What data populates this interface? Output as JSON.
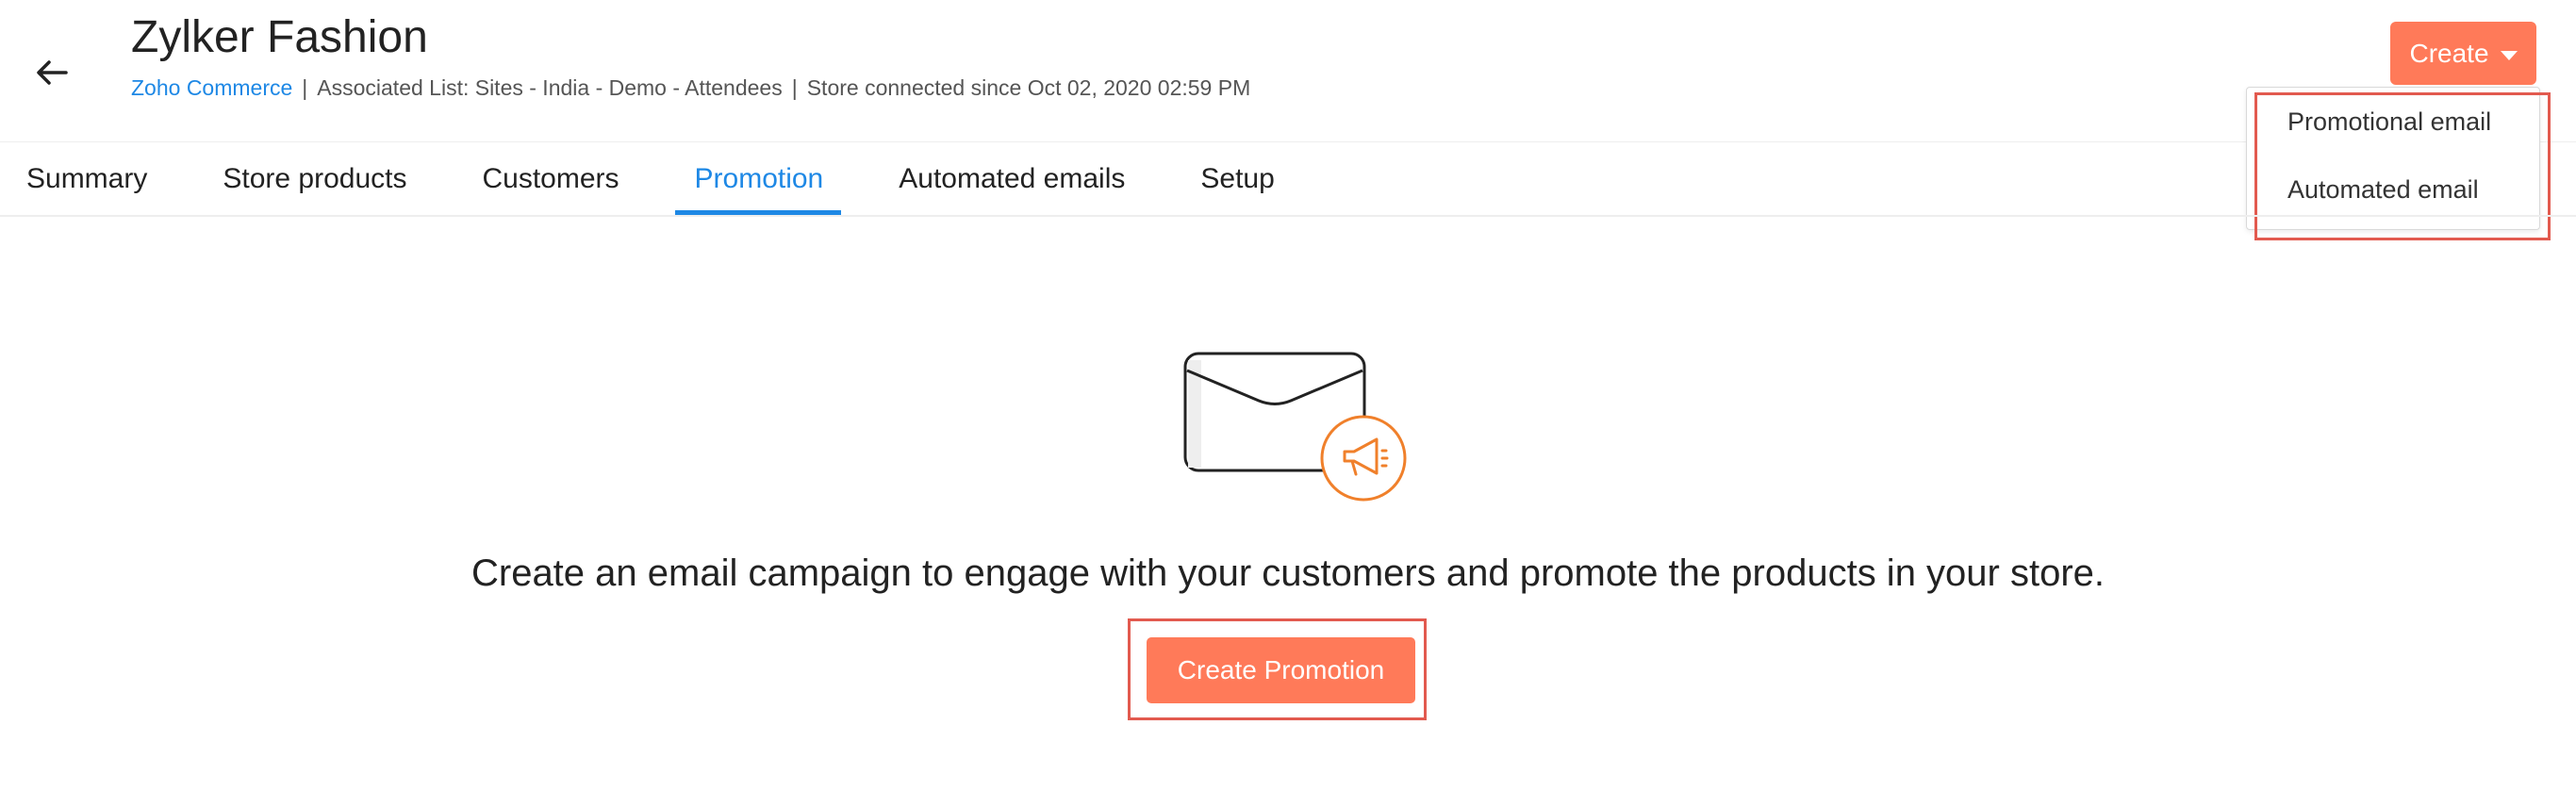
{
  "header": {
    "back_icon": "arrow-left-icon",
    "title": "Zylker Fashion",
    "meta": {
      "platform_link": "Zoho Commerce",
      "associated_list": "Associated List: Sites - India - Demo - Attendees",
      "connected_since": "Store connected since Oct 02, 2020 02:59 PM",
      "separator": "|"
    }
  },
  "create_menu": {
    "button_label": "Create",
    "caret_icon": "caret-down-icon",
    "items": [
      {
        "label": "Promotional email"
      },
      {
        "label": "Automated email"
      }
    ]
  },
  "tabs": [
    {
      "label": "Summary",
      "active": false
    },
    {
      "label": "Store products",
      "active": false
    },
    {
      "label": "Customers",
      "active": false
    },
    {
      "label": "Promotion",
      "active": true
    },
    {
      "label": "Automated emails",
      "active": false
    },
    {
      "label": "Setup",
      "active": false
    }
  ],
  "empty_state": {
    "illustration": "envelope-megaphone-icon",
    "message": "Create an email campaign to engage with your customers and promote the products in your store.",
    "button_label": "Create Promotion"
  },
  "colors": {
    "accent": "#ff7a59",
    "link": "#1e88e5",
    "highlight_border": "#e25a4f"
  }
}
